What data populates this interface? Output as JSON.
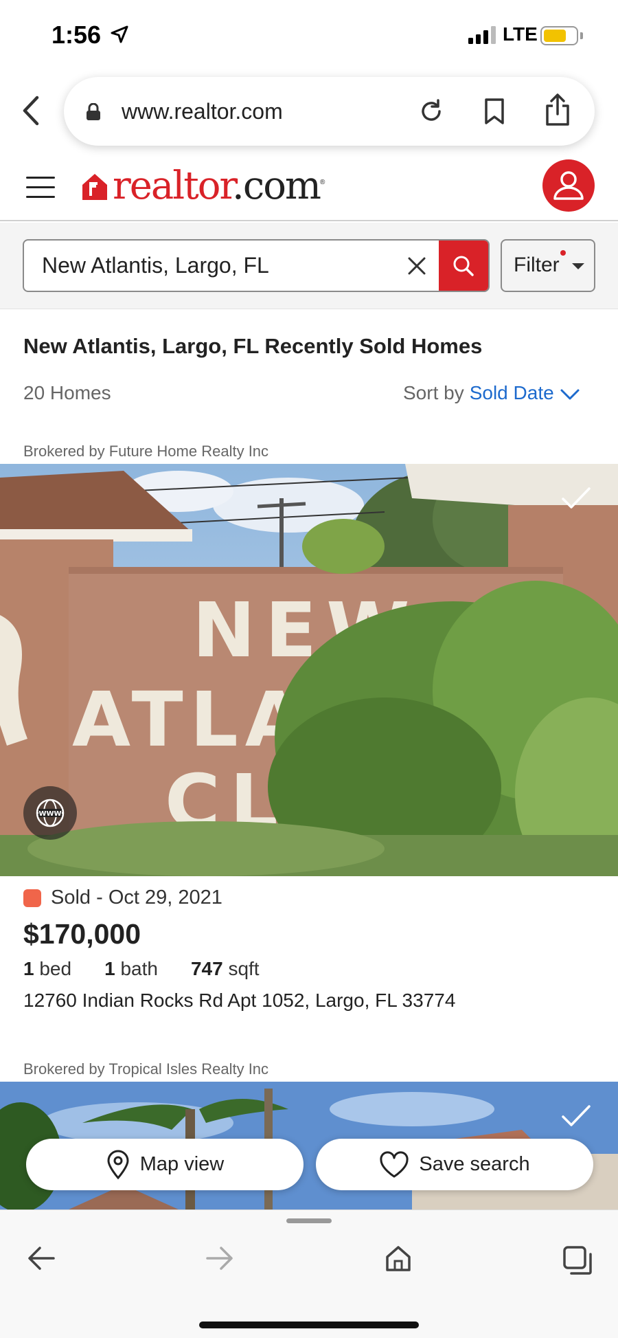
{
  "status_bar": {
    "time": "1:56",
    "network": "LTE",
    "icons": [
      "location-arrow-icon",
      "signal-icon",
      "battery-icon"
    ]
  },
  "browser": {
    "url": "www.realtor.com",
    "icons": [
      "back-chevron-icon",
      "lock-icon",
      "reload-icon",
      "bookmark-icon",
      "share-icon"
    ]
  },
  "site": {
    "logo_brand": "realtor",
    "logo_suffix": ".com",
    "brand_color": "#d92228"
  },
  "search": {
    "value": "New Atlantis, Largo, FL",
    "filter_label": "Filter"
  },
  "results": {
    "title": "New Atlantis, Largo, FL Recently Sold Homes",
    "count": "20 Homes",
    "sort_label": "Sort by",
    "sort_value": "Sold Date"
  },
  "listings": [
    {
      "broker": "Brokered by Future Home Realty Inc",
      "photo_sign": [
        "NEW",
        "ATLANT",
        "CLU"
      ],
      "status": "Sold - Oct 29, 2021",
      "status_color": "#f0654a",
      "price": "$170,000",
      "beds": "1",
      "beds_unit": "bed",
      "baths": "1",
      "baths_unit": "bath",
      "sqft": "747",
      "sqft_unit": "sqft",
      "address": "12760 Indian Rocks Rd Apt 1052, Largo, FL 33774"
    },
    {
      "broker": "Brokered by Tropical Isles Realty Inc"
    }
  ],
  "floating_actions": {
    "map_view": "Map view",
    "save_search": "Save search"
  },
  "bottom_nav": {
    "icons": [
      "nav-back-icon",
      "nav-forward-icon",
      "nav-home-icon",
      "tabs-icon"
    ]
  }
}
